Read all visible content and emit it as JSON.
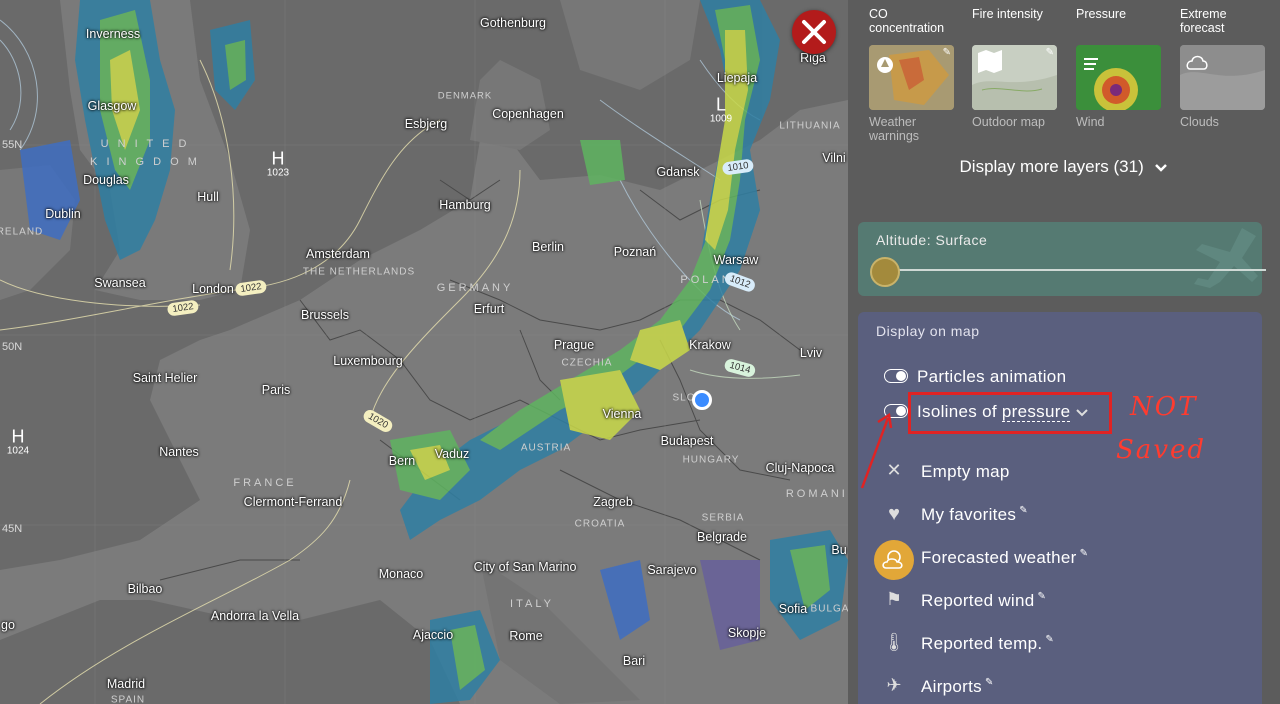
{
  "map": {
    "cities": [
      "Inverness",
      "Glasgow",
      "Douglas",
      "Dublin",
      "Hull",
      "Swansea",
      "London",
      "Amsterdam",
      "Brussels",
      "Luxembourg",
      "Saint Helier",
      "Paris",
      "Nantes",
      "Clermont-Ferrand",
      "Bern",
      "Vaduz",
      "Monaco",
      "Bilbao",
      "Andorra la Vella",
      "Madrid",
      "Ajaccio",
      "Rome",
      "City of San Marino",
      "Bari",
      "Zagreb",
      "Vienna",
      "Budapest",
      "Prague",
      "Berlin",
      "Hamburg",
      "Erfurt",
      "Poznań",
      "Warsaw",
      "Krakow",
      "Gdansk",
      "Copenhagen",
      "Esbjerg",
      "Gothenburg",
      "Liepaja",
      "Riga",
      "Vilni",
      "Lviv",
      "Cluj-Napoca",
      "Belgrade",
      "Sarajevo",
      "Skopje",
      "Sofia",
      "Bu"
    ],
    "countries": [
      "U N I T E D",
      "K I N G D O M",
      "DENMARK",
      "THE NETHERLANDS",
      "GERMANY",
      "POLAND",
      "LITHUANIA",
      "CZECHIA",
      "AUSTRIA",
      "HUNGARY",
      "FRANCE",
      "CROATIA",
      "SERBIA",
      "ROMANIA",
      "ITALY",
      "BULGA",
      "SPAIN",
      "RELAND",
      "SLO"
    ],
    "lat_labels": [
      "55N",
      "50N",
      "45N"
    ],
    "pressure_centers": [
      {
        "letter": "H",
        "value": "1023"
      },
      {
        "letter": "H",
        "value": "1024"
      },
      {
        "letter": "L",
        "value": "1009"
      }
    ],
    "isobar_labels": [
      "1022",
      "1022",
      "1020",
      "1010",
      "1012",
      "1014"
    ],
    "partial_labels": [
      "go"
    ]
  },
  "close_icon": "close-icon",
  "panel": {
    "top_labels": [
      "CO concentration",
      "Fire intensity",
      "Pressure",
      "Extreme forecast"
    ],
    "tiles": [
      {
        "label": "Weather warnings",
        "icon": "warning-icon"
      },
      {
        "label": "Outdoor map",
        "icon": "map-icon"
      },
      {
        "label": "Wind",
        "icon": "wind-icon"
      },
      {
        "label": "Clouds",
        "icon": "cloud-icon"
      }
    ],
    "more_layers": "Display more layers (31)",
    "altitude": {
      "label": "Altitude: Surface",
      "level": 0
    },
    "display": {
      "title": "Display on map",
      "particles": "Particles animation",
      "isolines_prefix": "Isolines of",
      "isolines_value": "pressure",
      "items": [
        {
          "label": "Empty map",
          "icon": "x-icon",
          "pinned": false
        },
        {
          "label": "My favorites",
          "icon": "heart-icon",
          "pinned": true
        },
        {
          "label": "Forecasted weather",
          "icon": "sun-cloud-icon",
          "pinned": true
        },
        {
          "label": "Reported wind",
          "icon": "windsock-icon",
          "pinned": true
        },
        {
          "label": "Reported temp.",
          "icon": "thermometer-icon",
          "pinned": true
        },
        {
          "label": "Airports",
          "icon": "airplane-icon",
          "pinned": true
        }
      ]
    }
  },
  "annotation": {
    "line1": "NOT",
    "line2": "Saved"
  },
  "colors": {
    "annotation": "#e02323",
    "panel_bg": "#5c5c5c",
    "display_box": "#5a5f7e",
    "altitude_box": "#557a72",
    "close_button": "#b31b1b"
  }
}
